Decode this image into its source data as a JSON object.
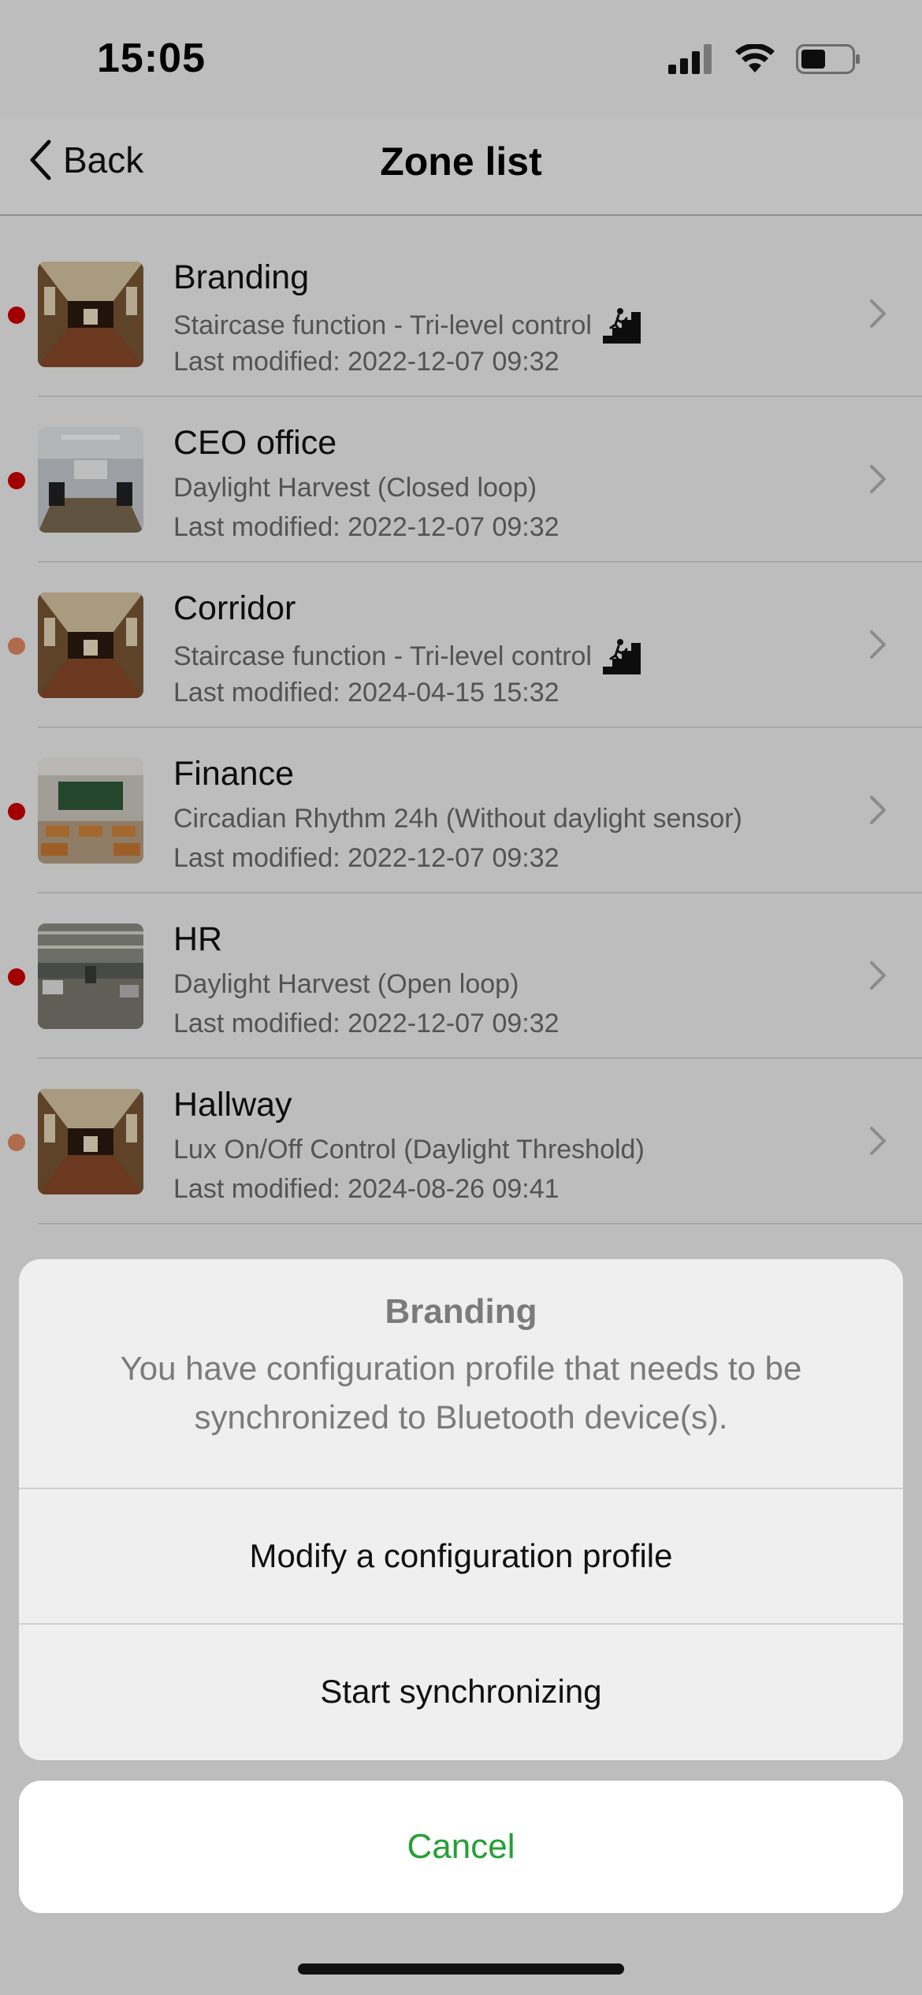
{
  "status_bar": {
    "time": "15:05"
  },
  "nav": {
    "back_label": "Back",
    "title": "Zone list"
  },
  "colors": {
    "dot_red": "#d00000",
    "dot_orange": "#e08a60",
    "accent_green": "#23a033"
  },
  "zones": [
    {
      "name": "Branding",
      "mode": "Staircase function - Tri-level control",
      "modified": "Last modified: 2022-12-07 09:32",
      "dot": "red",
      "thumb": "corridor",
      "icon": "staircase-person-icon"
    },
    {
      "name": "CEO office",
      "mode": "Daylight Harvest (Closed loop)",
      "modified": "Last modified: 2022-12-07 09:32",
      "dot": "red",
      "thumb": "office"
    },
    {
      "name": "Corridor",
      "mode": "Staircase function - Tri-level control",
      "modified": "Last modified: 2024-04-15 15:32",
      "dot": "orange",
      "thumb": "corridor",
      "icon": "staircase-person-icon"
    },
    {
      "name": "Finance",
      "mode": "Circadian Rhythm 24h (Without daylight sensor)",
      "modified": "Last modified: 2022-12-07 09:32",
      "dot": "red",
      "thumb": "classroom"
    },
    {
      "name": "HR",
      "mode": "Daylight Harvest (Open loop)",
      "modified": "Last modified: 2022-12-07 09:32",
      "dot": "red",
      "thumb": "garage"
    },
    {
      "name": "Hallway",
      "mode": "Lux On/Off Control (Daylight Threshold)",
      "modified": "Last modified: 2024-08-26 09:41",
      "dot": "orange",
      "thumb": "corridor"
    }
  ],
  "action_sheet": {
    "title": "Branding",
    "message": "You have configuration profile that needs to be synchronized to Bluetooth device(s).",
    "modify_label": "Modify a configuration profile",
    "sync_label": "Start synchronizing",
    "cancel_label": "Cancel"
  }
}
